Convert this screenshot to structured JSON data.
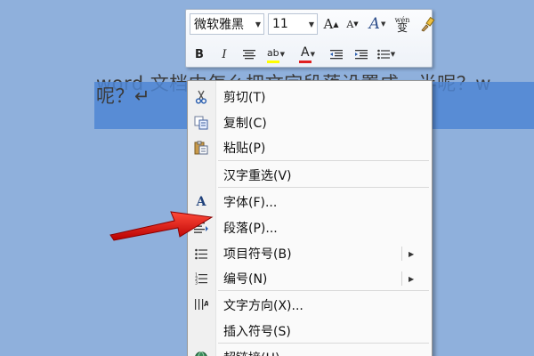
{
  "document": {
    "line1": "word 文档中怎么把文字段落设置成一半呢？w",
    "line2": "呢？↵"
  },
  "mini_toolbar": {
    "font_name": "微软雅黑",
    "font_size": "11",
    "grow_font": "A",
    "shrink_font": "A",
    "styles": "A",
    "phonetic": "wén",
    "phonetic_char": "变",
    "bold": "B",
    "italic": "I",
    "highlight": "ab",
    "font_color": "A",
    "highlight_color": "#ffff00",
    "font_color_value": "#e02020"
  },
  "context_menu": {
    "items": [
      {
        "label": "剪切(T)",
        "icon": "scissors-icon"
      },
      {
        "label": "复制(C)",
        "icon": "copy-icon"
      },
      {
        "label": "粘贴(P)",
        "icon": "paste-icon"
      },
      {
        "label": "汉字重选(V)",
        "icon": ""
      },
      {
        "label": "字体(F)...",
        "icon": "font-icon"
      },
      {
        "label": "段落(P)...",
        "icon": "paragraph-icon"
      },
      {
        "label": "项目符号(B)",
        "icon": "bullets-icon"
      },
      {
        "label": "编号(N)",
        "icon": "numbering-icon"
      },
      {
        "label": "文字方向(X)...",
        "icon": "text-direction-icon"
      },
      {
        "label": "插入符号(S)",
        "icon": ""
      },
      {
        "label": "超链接(H)...",
        "icon": "hyperlink-icon"
      }
    ]
  },
  "colors": {
    "background": "#8fb0dc",
    "selection": "#4f86d3",
    "arrow": "#e01010"
  }
}
